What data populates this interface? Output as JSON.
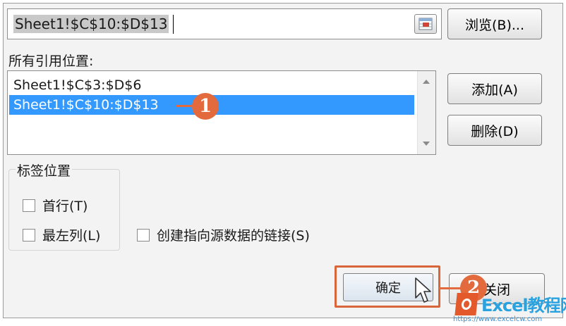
{
  "dialog": {
    "reference_value": "Sheet1!$C$10:$D$13",
    "browse_label": "浏览(B)...",
    "all_references_label": "所有引用位置:",
    "all_references": [
      "Sheet1!$C$3:$D$6",
      "Sheet1!$C$10:$D$13"
    ],
    "selected_reference_index": 1,
    "add_label": "添加(A)",
    "delete_label": "删除(D)",
    "use_labels_title": "标签位置",
    "top_row_label": "首行(T)",
    "left_column_label": "最左列(L)",
    "create_links_label": "创建指向源数据的链接(S)",
    "ok_label": "确定",
    "close_label": "关闭"
  },
  "annotations": {
    "step1": "1",
    "step2": "2",
    "accent_color": "#e26a3c"
  },
  "watermark": {
    "brand": "Excel教程网",
    "url": "https://www.excelcw.com"
  },
  "icons": {
    "collapse": "range-collapse-icon",
    "cursor": "mouse-pointer-icon"
  }
}
